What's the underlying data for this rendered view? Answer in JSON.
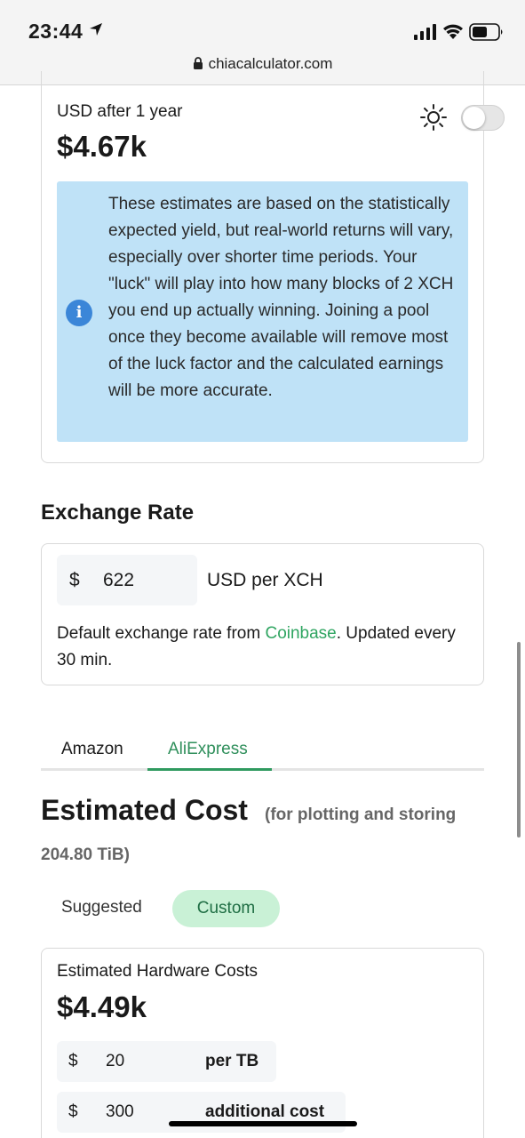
{
  "status_bar": {
    "time": "23:44",
    "url": "chiacalculator.com"
  },
  "earnings": {
    "label": "USD after 1 year",
    "value": "$4.67k",
    "theme_toggle_on": false
  },
  "info_box": {
    "text": "These estimates are based on the statistically expected yield, but real-world returns will vary, especially over shorter time periods. Your \"luck\" will play into how many blocks of 2 XCH you end up actually winning. Joining a pool once they become available will remove most of the luck factor and the calculated earnings will be more accurate."
  },
  "exchange_rate": {
    "heading": "Exchange Rate",
    "currency_symbol": "$",
    "value": "622",
    "unit": "USD per XCH",
    "note_prefix": "Default exchange rate from ",
    "note_link": "Coinbase",
    "note_suffix": ". Updated every 30 min."
  },
  "tabs": [
    {
      "label": "Amazon",
      "active": false
    },
    {
      "label": "AliExpress",
      "active": true
    }
  ],
  "estimated_cost": {
    "heading": "Estimated Cost",
    "subheading_line1": "(for plotting and storing",
    "subheading_line2": "204.80 TiB)",
    "toggle_options": [
      {
        "label": "Suggested",
        "active": false
      },
      {
        "label": "Custom",
        "active": true
      }
    ]
  },
  "hardware_costs": {
    "label": "Estimated Hardware Costs",
    "value": "$4.49k",
    "rows": [
      {
        "symbol": "$",
        "value": "20",
        "unit": "per TB"
      },
      {
        "symbol": "$",
        "value": "300",
        "unit": "additional cost"
      }
    ]
  },
  "colors": {
    "accent_green": "#2f9a5f",
    "link_green": "#2fa561",
    "info_bg": "#bfe2f7",
    "info_icon": "#3b86d8",
    "pill_bg": "#c9f1d6"
  }
}
